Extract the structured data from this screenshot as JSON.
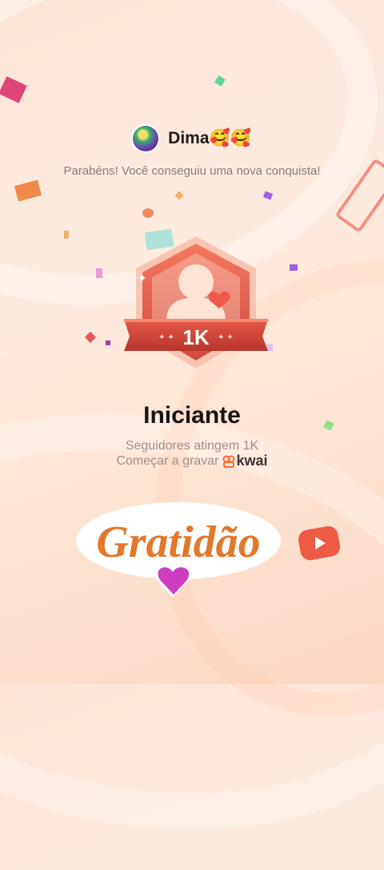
{
  "user": {
    "name": "Dima🥰🥰"
  },
  "congrats_text": "Parabéns! Você conseguiu uma nova conquista!",
  "badge": {
    "level_text": "1K"
  },
  "achievement": {
    "title": "Iniciante",
    "subtitle": "Seguidores atingem 1K",
    "cta_text": "Começar a gravar",
    "brand": "kwai"
  },
  "sticker": {
    "text": "Gratidão"
  },
  "colors": {
    "accent": "#d9533f",
    "brand": "#ff6a2b",
    "sticker_text": "#e2782c",
    "heart": "#cf3dbf"
  }
}
